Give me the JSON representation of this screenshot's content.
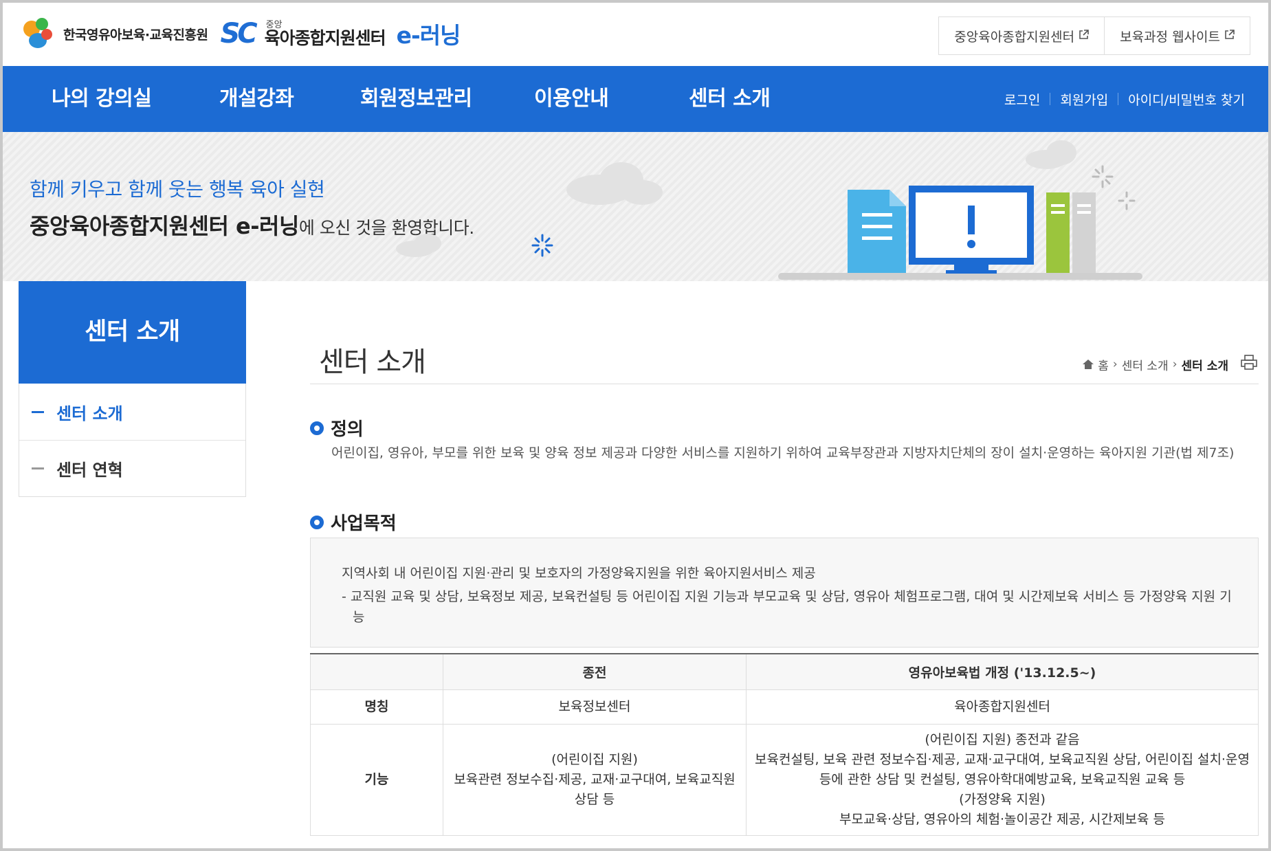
{
  "header": {
    "org_name": "한국영유아보육·교육진흥원",
    "logo_sc": "SC",
    "center_small": "중앙",
    "center_name": "육아종합지원센터",
    "elearning": "e-러닝",
    "ext_links": [
      {
        "label": "중앙육아종합지원센터",
        "icon": "external-link-icon"
      },
      {
        "label": "보육과정 웹사이트",
        "icon": "external-link-icon"
      }
    ]
  },
  "nav": {
    "items": [
      "나의 강의실",
      "개설강좌",
      "회원정보관리",
      "이용안내",
      "센터 소개"
    ],
    "util": [
      "로그인",
      "회원가입",
      "아이디/비밀번호 찾기"
    ]
  },
  "banner": {
    "subtitle": "함께 키우고 함께 웃는 행복 육아 실현",
    "title_bold": "중앙육아종합지원센터 e-러닝",
    "title_rest": "에 오신 것을 환영합니다."
  },
  "sidebar": {
    "heading": "센터 소개",
    "items": [
      {
        "label": "센터 소개",
        "active": true
      },
      {
        "label": "센터 연혁",
        "active": false
      }
    ]
  },
  "content": {
    "title": "센터 소개",
    "breadcrumb": {
      "home": "홈",
      "section": "센터 소개",
      "current": "센터 소개"
    },
    "definition": {
      "heading": "정의",
      "text": "어린이집, 영유아, 부모를 위한 보육 및 양육 정보 제공과 다양한 서비스를 지원하기 위하여 교육부장관과 지방자치단체의 장이 설치·운영하는 육아지원 기관(법 제7조)"
    },
    "purpose": {
      "heading": "사업목적",
      "line1": "지역사회 내 어린이집 지원·관리 및 보호자의 가정양육지원을 위한 육아지원서비스 제공",
      "line2": "- 교직원 교육 및 상담, 보육정보 제공, 보육컨설팅 등 어린이집 지원 기능과 부모교육 및 상담, 영유아 체험프로그램, 대여 및 시간제보육 서비스 등 가정양육 지원 기능"
    },
    "table": {
      "headers": [
        "",
        "종전",
        "영유아보육법 개정 ('13.12.5~)"
      ],
      "rows": [
        {
          "label": "명칭",
          "before": "보육정보센터",
          "after": "육아종합지원센터"
        },
        {
          "label": "기능",
          "before": "(어린이집 지원)\n보육관련 정보수집·제공, 교재·교구대여, 보육교직원 상담 등",
          "after": "(어린이집 지원) 종전과 같음\n보육컨설팅, 보육 관련 정보수집·제공, 교재·교구대여, 보육교직원 상담, 어린이집 설치·운영 등에 관한 상담 및 컨설팅, 영유아학대예방교육, 보육교직원 교육 등\n(가정양육 지원)\n부모교육·상담, 영유아의 체험·놀이공간 제공, 시간제보육 등"
        }
      ]
    }
  },
  "colors": {
    "brand_blue": "#1c6bd3",
    "banner_bg": "#efefef"
  }
}
